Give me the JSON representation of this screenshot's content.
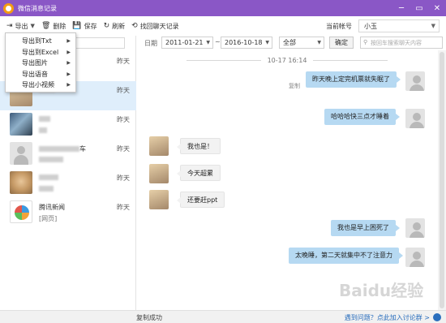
{
  "window": {
    "title": "微信消息记录",
    "buttons": [
      "─",
      "▭",
      "✕"
    ]
  },
  "toolbar": {
    "export_label": "导出",
    "delete_label": "删除",
    "save_label": "保存",
    "refresh_label": "刷新",
    "recover_label": "找回聊天记录",
    "account_label": "当前帐号",
    "account_value": "小玉"
  },
  "export_menu": {
    "items": [
      "导出到Txt",
      "导出到Excel",
      "导出图片",
      "导出语音",
      "导出小视频"
    ]
  },
  "sidebar": {
    "chats": [
      {
        "name": "",
        "preview": "",
        "time": "昨天"
      },
      {
        "name": "",
        "preview": "",
        "time": "昨天"
      },
      {
        "name": "",
        "preview": "",
        "time": "昨天"
      },
      {
        "name": "车",
        "preview": "",
        "time": "昨天"
      },
      {
        "name": "",
        "preview": "",
        "time": "昨天"
      },
      {
        "name": "腾讯新闻",
        "preview": "[网页]",
        "time": "昨天"
      }
    ]
  },
  "filter": {
    "date_label": "日期",
    "start_date": "2011-01-21",
    "date_separator": "~",
    "end_date": "2016-10-18",
    "type": "全部",
    "confirm_label": "确定",
    "search_placeholder": "按回车搜索聊天内容"
  },
  "messages": {
    "date_divider": "10-17 16:14",
    "copy_label": "复制",
    "items": [
      {
        "direction": "out",
        "text": "昨天晚上定完机票就失眠了"
      },
      {
        "direction": "out",
        "text": "哈哈哈快三点才睡着"
      },
      {
        "direction": "in",
        "text": "我也是！"
      },
      {
        "direction": "in",
        "text": "今天超累"
      },
      {
        "direction": "in",
        "text": "还要赶ppt"
      },
      {
        "direction": "out",
        "text": "我也是早上困死了"
      },
      {
        "direction": "out",
        "text": "太晚睡，第二天就集中不了注意力"
      }
    ]
  },
  "status": {
    "text": "复制成功",
    "feedback": "遇到问题？点此加入讨论群 >"
  },
  "watermark": "Baidu经验",
  "colors": {
    "titlebar": "#8a57c6",
    "bubble_out": "#b6d9f2",
    "bubble_in": "#f2f2f2",
    "selected_row": "#dfeefb",
    "link": "#2a6ebd"
  }
}
